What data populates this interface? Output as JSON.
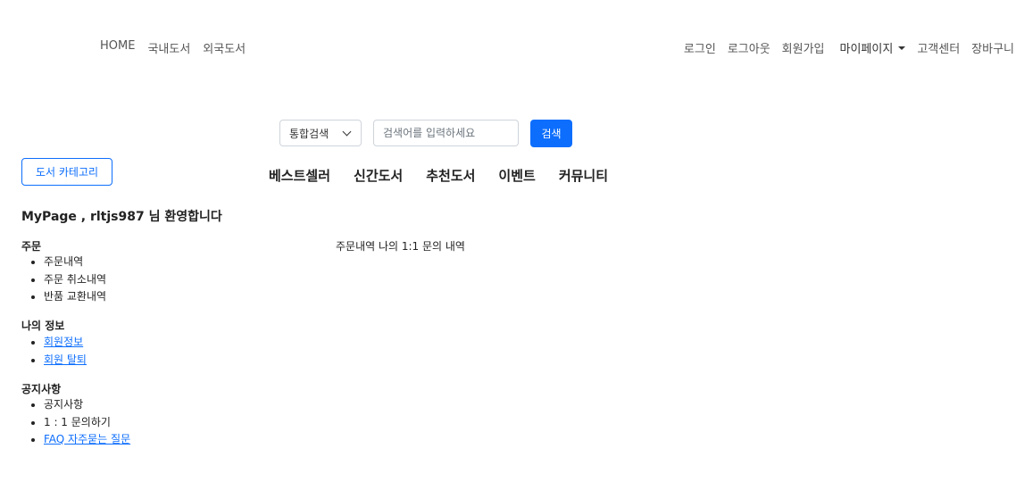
{
  "top_nav": {
    "left": [
      "HOME",
      "국내도서",
      "외국도서"
    ],
    "right": [
      "로그인",
      "로그아웃",
      "회원가입"
    ],
    "mypage_label": "마이페이지",
    "right_tail": [
      "고객센터",
      "장바구니"
    ]
  },
  "search": {
    "select_value": "통합검색",
    "input_value": "",
    "placeholder": "검색어를 입력하세요",
    "button_label": "검색"
  },
  "category_button_label": "도서 카테고리",
  "main_menu": [
    "베스트셀러",
    "신간도서",
    "추천도서",
    "이벤트",
    "커뮤니티"
  ],
  "welcome_text": "MyPage , rltjs987 님 환영합니다",
  "sections": [
    {
      "title": "주문",
      "items": [
        {
          "label": "주문내역",
          "link": false
        },
        {
          "label": "주문 취소내역",
          "link": false
        },
        {
          "label": "반품 교환내역",
          "link": false
        }
      ]
    },
    {
      "title": "나의 정보",
      "items": [
        {
          "label": "회원정보",
          "link": true
        },
        {
          "label": "회원 탈퇴",
          "link": true
        }
      ]
    },
    {
      "title": "공지사항",
      "items": [
        {
          "label": "공지사항",
          "link": false
        },
        {
          "label": "1 : 1 문의하기",
          "link": false
        },
        {
          "label": "FAQ 자주묻는 질문",
          "link": true
        }
      ]
    }
  ],
  "content_text": "주문내역 나의 1:1 문의 내역",
  "colors": {
    "accent": "#0d6efd",
    "nav_text": "#555555"
  }
}
